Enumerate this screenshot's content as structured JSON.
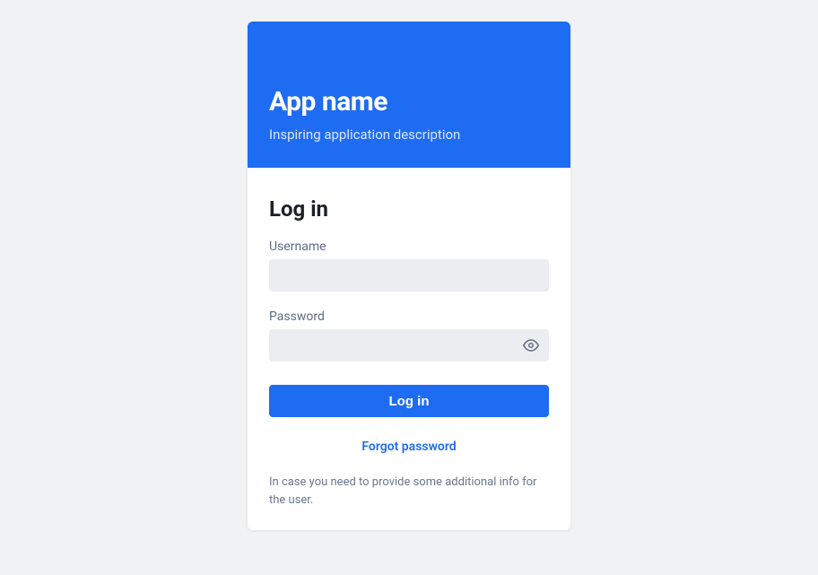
{
  "header": {
    "title": "App name",
    "subtitle": "Inspiring application description"
  },
  "form": {
    "title": "Log in",
    "username": {
      "label": "Username",
      "value": ""
    },
    "password": {
      "label": "Password",
      "value": ""
    },
    "submit_label": "Log in",
    "forgot_label": "Forgot password",
    "helper_text": "In case you need to provide some additional info for the user."
  },
  "colors": {
    "accent": "#1e6cf2",
    "input_bg": "#ebedf0",
    "page_bg": "#f1f2f4"
  }
}
